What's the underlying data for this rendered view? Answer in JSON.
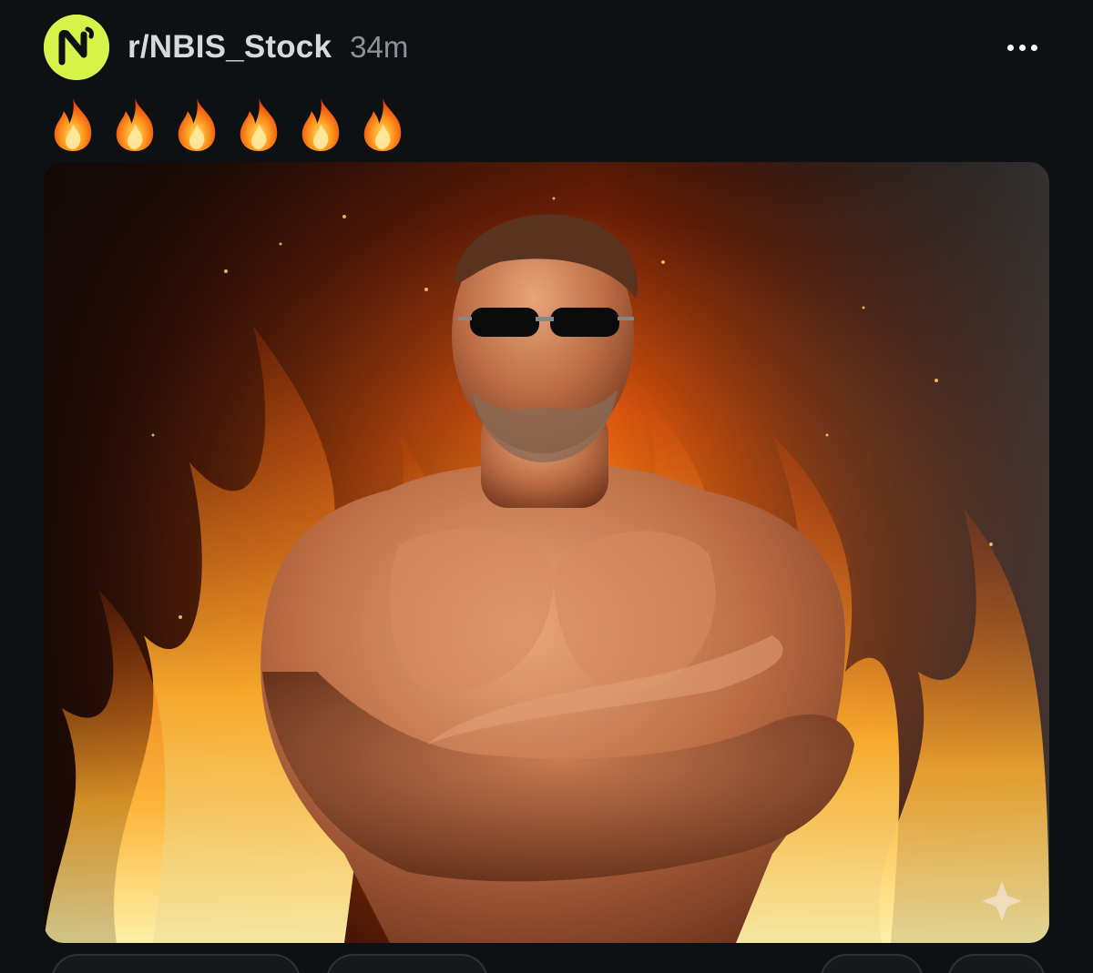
{
  "post": {
    "community": "r/NBIS_Stock",
    "time_ago": "34m",
    "avatar_letter": "N",
    "title_emojis": [
      "fire",
      "fire",
      "fire",
      "fire",
      "fire",
      "fire"
    ]
  },
  "colors": {
    "background": "#0e1113",
    "avatar_bg": "#d7f34a",
    "avatar_fg": "#0e1113",
    "community_text": "#d7dadc",
    "muted_text": "#8b9399"
  },
  "icons": {
    "more": "more-horizontal-icon",
    "title": "fire-emoji-icon",
    "image_badge": "sparkle-icon"
  }
}
